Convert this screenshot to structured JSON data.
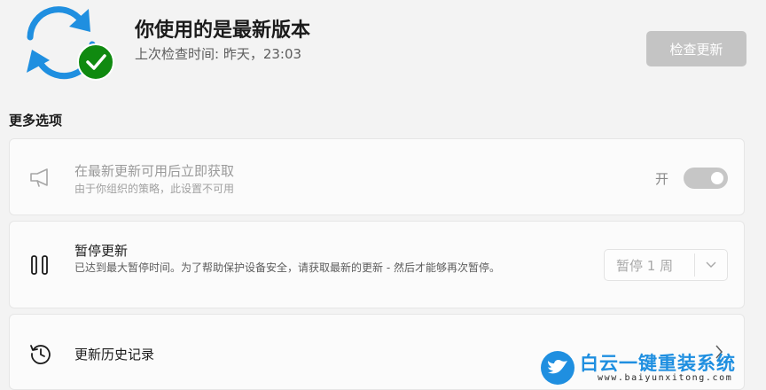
{
  "header": {
    "title": "你使用的是最新版本",
    "subtitle": "上次检查时间: 昨天，23:03",
    "check_button_label": "检查更新",
    "icons": [
      "sync-icon",
      "checkmark-icon"
    ]
  },
  "more_options": {
    "title": "更多选项",
    "cards": [
      {
        "icon": "megaphone-icon",
        "title": "在最新更新可用后立即获取",
        "description": "由于你组织的策略，此设置不可用",
        "toggle_label": "开",
        "toggle_on": true,
        "disabled": true
      },
      {
        "icon": "pause-icon",
        "title": "暂停更新",
        "description": "已达到最大暂停时间。为了帮助保护设备安全，请获取最新的更新 - 然后才能够再次暂停。",
        "select_value": "暂停 1 周",
        "select_icon": "chevron-down-icon"
      },
      {
        "icon": "history-icon",
        "title": "更新历史记录",
        "trailing_icon": "chevron-right-icon"
      }
    ]
  },
  "watermark": {
    "brand": "白云一键重装系统",
    "url": "www.baiyunxitong.com",
    "icon": "bird-logo-icon"
  },
  "colors": {
    "accent_blue": "#1f8fe0",
    "success_green": "#108a10",
    "disabled_button": "#c4c4c4",
    "background": "#f3f3f3"
  }
}
